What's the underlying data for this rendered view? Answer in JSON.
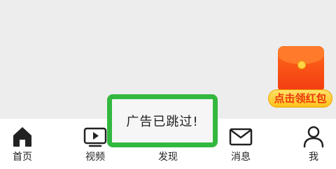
{
  "promo": {
    "label": "点击领红包",
    "icon": "red-envelope-icon"
  },
  "toast": {
    "message": "广告已跳过!"
  },
  "tabs": [
    {
      "label": "首页",
      "icon": "home-icon",
      "active": true
    },
    {
      "label": "视频",
      "icon": "video-play-icon",
      "active": false
    },
    {
      "label": "发现",
      "icon": "discover-icon",
      "active": false
    },
    {
      "label": "消息",
      "icon": "mail-icon",
      "active": false
    },
    {
      "label": "我",
      "icon": "user-icon",
      "active": false
    }
  ],
  "colors": {
    "toast_border": "#33b83f",
    "envelope_red": "#f23b12",
    "envelope_gold": "#ffc21a",
    "tab_icon": "#222222"
  }
}
